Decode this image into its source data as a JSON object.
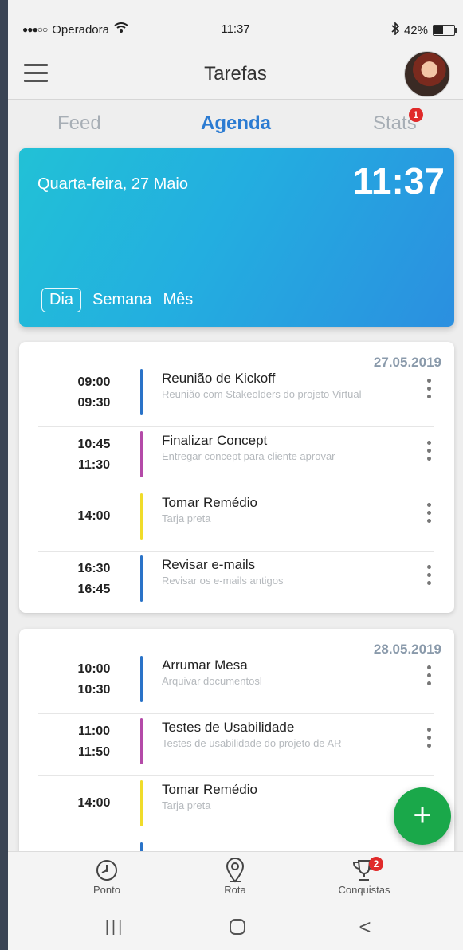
{
  "status": {
    "carrier": "Operadora",
    "time": "11:37",
    "battery": "42%",
    "battery_level": 0.42
  },
  "header": {
    "title": "Tarefas"
  },
  "tabs": {
    "feed": "Feed",
    "agenda": "Agenda",
    "stats": "Stats",
    "stats_badge": "1"
  },
  "hero": {
    "date": "Quarta-feira, 27 Maio",
    "clock": "11:37",
    "periods": [
      "Dia",
      "Semana",
      "Mês"
    ]
  },
  "days": [
    {
      "date": "27.05.2019",
      "tasks": [
        {
          "start": "09:00",
          "end": "09:30",
          "title": "Reunião de Kickoff",
          "subtitle": "Reunião com Stakeolders do projeto Virtual",
          "color": "#2a73c8"
        },
        {
          "start": "10:45",
          "end": "11:30",
          "title": "Finalizar Concept",
          "subtitle": "Entregar concept para cliente aprovar",
          "color": "#b44aa8"
        },
        {
          "start": "14:00",
          "end": "",
          "title": "Tomar Remédio",
          "subtitle": "Tarja preta",
          "color": "#f0dc2a"
        },
        {
          "start": "16:30",
          "end": "16:45",
          "title": "Revisar e-mails",
          "subtitle": "Revisar os e-mails antigos",
          "color": "#2a73c8"
        }
      ]
    },
    {
      "date": "28.05.2019",
      "tasks": [
        {
          "start": "10:00",
          "end": "10:30",
          "title": "Arrumar Mesa",
          "subtitle": "Arquivar documentosl",
          "color": "#2a73c8"
        },
        {
          "start": "11:00",
          "end": "11:50",
          "title": "Testes de Usabilidade",
          "subtitle": "Testes de usabilidade do projeto de AR",
          "color": "#b44aa8"
        },
        {
          "start": "14:00",
          "end": "",
          "title": "Tomar Remédio",
          "subtitle": "Tarja preta",
          "color": "#f0dc2a"
        }
      ]
    }
  ],
  "fab": {
    "label": "+"
  },
  "bottom_nav": {
    "ponto": "Ponto",
    "rota": "Rota",
    "conquistas": "Conquistas",
    "conquistas_badge": "2"
  },
  "system_nav": {
    "recents": "|||",
    "back": "<"
  }
}
